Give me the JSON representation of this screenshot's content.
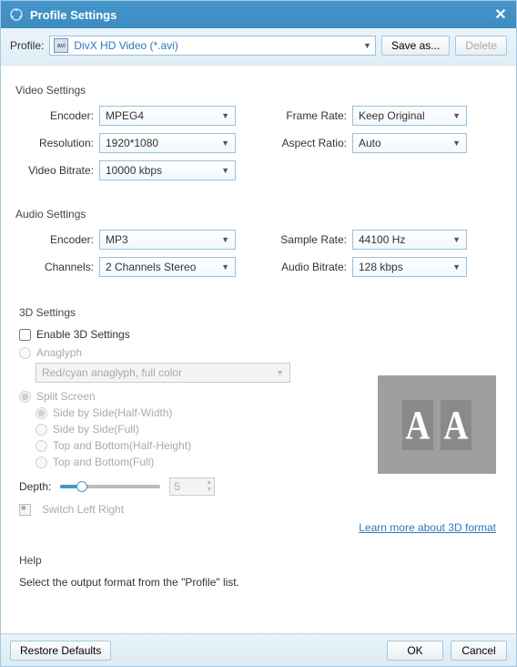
{
  "titlebar": {
    "title": "Profile Settings"
  },
  "profile": {
    "label": "Profile:",
    "value": "DivX HD Video (*.avi)",
    "save_as": "Save as...",
    "delete": "Delete"
  },
  "video": {
    "heading": "Video Settings",
    "encoder_label": "Encoder:",
    "encoder": "MPEG4",
    "resolution_label": "Resolution:",
    "resolution": "1920*1080",
    "bitrate_label": "Video Bitrate:",
    "bitrate": "10000 kbps",
    "framerate_label": "Frame Rate:",
    "framerate": "Keep Original",
    "aspect_label": "Aspect Ratio:",
    "aspect": "Auto"
  },
  "audio": {
    "heading": "Audio Settings",
    "encoder_label": "Encoder:",
    "encoder": "MP3",
    "channels_label": "Channels:",
    "channels": "2 Channels Stereo",
    "samplerate_label": "Sample Rate:",
    "samplerate": "44100 Hz",
    "bitrate_label": "Audio Bitrate:",
    "bitrate": "128 kbps"
  },
  "threeD": {
    "heading": "3D Settings",
    "enable_label": "Enable 3D Settings",
    "anaglyph_label": "Anaglyph",
    "anaglyph_mode": "Red/cyan anaglyph, full color",
    "split_label": "Split Screen",
    "opt_sbs_half": "Side by Side(Half-Width)",
    "opt_sbs_full": "Side by Side(Full)",
    "opt_tb_half": "Top and Bottom(Half-Height)",
    "opt_tb_full": "Top and Bottom(Full)",
    "depth_label": "Depth:",
    "depth_value": "5",
    "switch_label": "Switch Left Right",
    "learn_more": "Learn more about 3D format"
  },
  "help": {
    "heading": "Help",
    "text": "Select the output format from the \"Profile\" list."
  },
  "footer": {
    "restore": "Restore Defaults",
    "ok": "OK",
    "cancel": "Cancel"
  }
}
